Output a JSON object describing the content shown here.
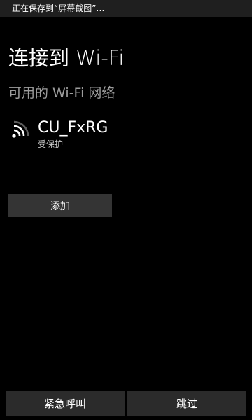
{
  "status_bar": {
    "text": "正在保存到“屏幕截图”…"
  },
  "header": {
    "title": "连接到 Wi-Fi"
  },
  "networks_section": {
    "title": "可用的 Wi-Fi 网络",
    "items": [
      {
        "name": "CU_FxRG",
        "status": "受保护",
        "icon": "wifi-signal-icon"
      }
    ]
  },
  "actions": {
    "add_label": "添加"
  },
  "footer": {
    "emergency_label": "紧急呼叫",
    "skip_label": "跳过"
  },
  "colors": {
    "background": "#000000",
    "status_bar": "#1f1f1f",
    "button": "#343434",
    "secondary_text": "#9d9d9d"
  }
}
